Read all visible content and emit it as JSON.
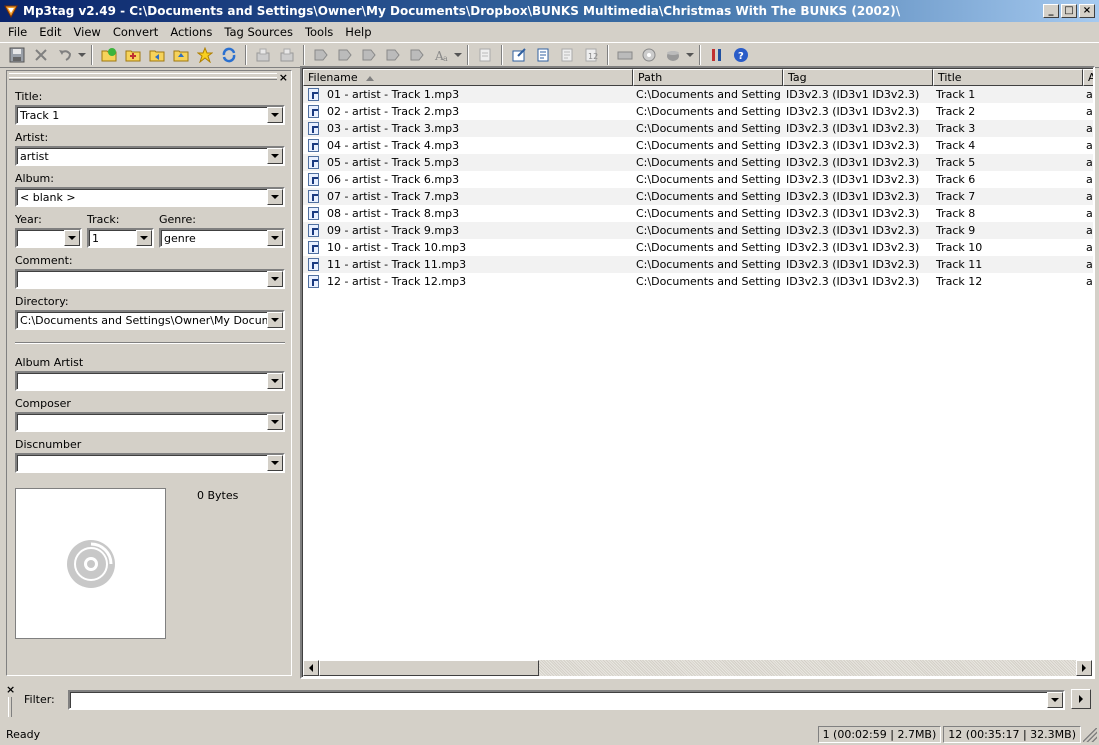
{
  "window": {
    "title": "Mp3tag v2.49  -  C:\\Documents and Settings\\Owner\\My Documents\\Dropbox\\BUNKS Multimedia\\Christmas With The BUNKS (2002)\\",
    "minimize": "_",
    "maximize": "□",
    "close": "×"
  },
  "menu": [
    "File",
    "Edit",
    "View",
    "Convert",
    "Actions",
    "Tag Sources",
    "Tools",
    "Help"
  ],
  "toolbar": {
    "icons": [
      "save-icon",
      "remove-icon",
      "undo-icon",
      "add-directory-icon",
      "add-folder-icon",
      "open-folder-icon",
      "favorite-icon",
      "refresh-icon",
      "copy-tag-icon",
      "paste-tag-icon",
      "tag-filename-icon",
      "filename-tag-icon",
      "filename-filename-icon",
      "text-tag-icon",
      "tag-tag-icon",
      "case-convert-icon",
      "extended-tags-icon",
      "export-icon",
      "playlist-icon",
      "playlist-sel-icon",
      "autonumber-icon",
      "freedb-icon",
      "amazon-icon",
      "tag-sources-icon",
      "options-icon",
      "help-icon"
    ]
  },
  "tag_panel": {
    "close": "×",
    "title_label": "Title:",
    "title_value": "Track 1",
    "artist_label": "Artist:",
    "artist_value": "artist",
    "album_label": "Album:",
    "album_value": "< blank >",
    "year_label": "Year:",
    "year_value": "",
    "track_label": "Track:",
    "track_value": "1",
    "genre_label": "Genre:",
    "genre_value": "genre",
    "comment_label": "Comment:",
    "comment_value": "",
    "directory_label": "Directory:",
    "directory_value": "C:\\Documents and Settings\\Owner\\My Documents\\Dropbox",
    "album_artist_label": "Album Artist",
    "album_artist_value": "",
    "composer_label": "Composer",
    "composer_value": "",
    "discnumber_label": "Discnumber",
    "discnumber_value": "",
    "cover_size": "0 Bytes"
  },
  "file_list": {
    "columns": [
      "Filename",
      "Path",
      "Tag",
      "Title",
      "A"
    ],
    "rows": [
      {
        "filename": "01 - artist - Track 1.mp3",
        "path": "C:\\Documents and Setting...",
        "tag": "ID3v2.3 (ID3v1 ID3v2.3)",
        "title": "Track 1",
        "a": "ar"
      },
      {
        "filename": "02 - artist - Track 2.mp3",
        "path": "C:\\Documents and Setting...",
        "tag": "ID3v2.3 (ID3v1 ID3v2.3)",
        "title": "Track 2",
        "a": "ar"
      },
      {
        "filename": "03 - artist - Track 3.mp3",
        "path": "C:\\Documents and Setting...",
        "tag": "ID3v2.3 (ID3v1 ID3v2.3)",
        "title": "Track 3",
        "a": "ar"
      },
      {
        "filename": "04 - artist - Track 4.mp3",
        "path": "C:\\Documents and Setting...",
        "tag": "ID3v2.3 (ID3v1 ID3v2.3)",
        "title": "Track 4",
        "a": "ar"
      },
      {
        "filename": "05 - artist - Track 5.mp3",
        "path": "C:\\Documents and Setting...",
        "tag": "ID3v2.3 (ID3v1 ID3v2.3)",
        "title": "Track 5",
        "a": "ar"
      },
      {
        "filename": "06 - artist - Track 6.mp3",
        "path": "C:\\Documents and Setting...",
        "tag": "ID3v2.3 (ID3v1 ID3v2.3)",
        "title": "Track 6",
        "a": "ar"
      },
      {
        "filename": "07 - artist - Track 7.mp3",
        "path": "C:\\Documents and Setting...",
        "tag": "ID3v2.3 (ID3v1 ID3v2.3)",
        "title": "Track 7",
        "a": "ar"
      },
      {
        "filename": "08 - artist - Track 8.mp3",
        "path": "C:\\Documents and Setting...",
        "tag": "ID3v2.3 (ID3v1 ID3v2.3)",
        "title": "Track 8",
        "a": "ar"
      },
      {
        "filename": "09 - artist - Track 9.mp3",
        "path": "C:\\Documents and Setting...",
        "tag": "ID3v2.3 (ID3v1 ID3v2.3)",
        "title": "Track 9",
        "a": "ar"
      },
      {
        "filename": "10 - artist - Track 10.mp3",
        "path": "C:\\Documents and Setting...",
        "tag": "ID3v2.3 (ID3v1 ID3v2.3)",
        "title": "Track 10",
        "a": "ar"
      },
      {
        "filename": "11 - artist - Track 11.mp3",
        "path": "C:\\Documents and Setting...",
        "tag": "ID3v2.3 (ID3v1 ID3v2.3)",
        "title": "Track 11",
        "a": "ar"
      },
      {
        "filename": "12 - artist - Track 12.mp3",
        "path": "C:\\Documents and Setting...",
        "tag": "ID3v2.3 (ID3v1 ID3v2.3)",
        "title": "Track 12",
        "a": "ar"
      }
    ]
  },
  "filter": {
    "close": "×",
    "label": "Filter:",
    "value": ""
  },
  "status": {
    "text": "Ready",
    "selected": "1 (00:02:59 | 2.7MB)",
    "total": "12 (00:35:17 | 32.3MB)"
  },
  "colors": {
    "titlebar_start": "#0a246a",
    "titlebar_end": "#a6caf0",
    "face": "#d4d0c8"
  }
}
